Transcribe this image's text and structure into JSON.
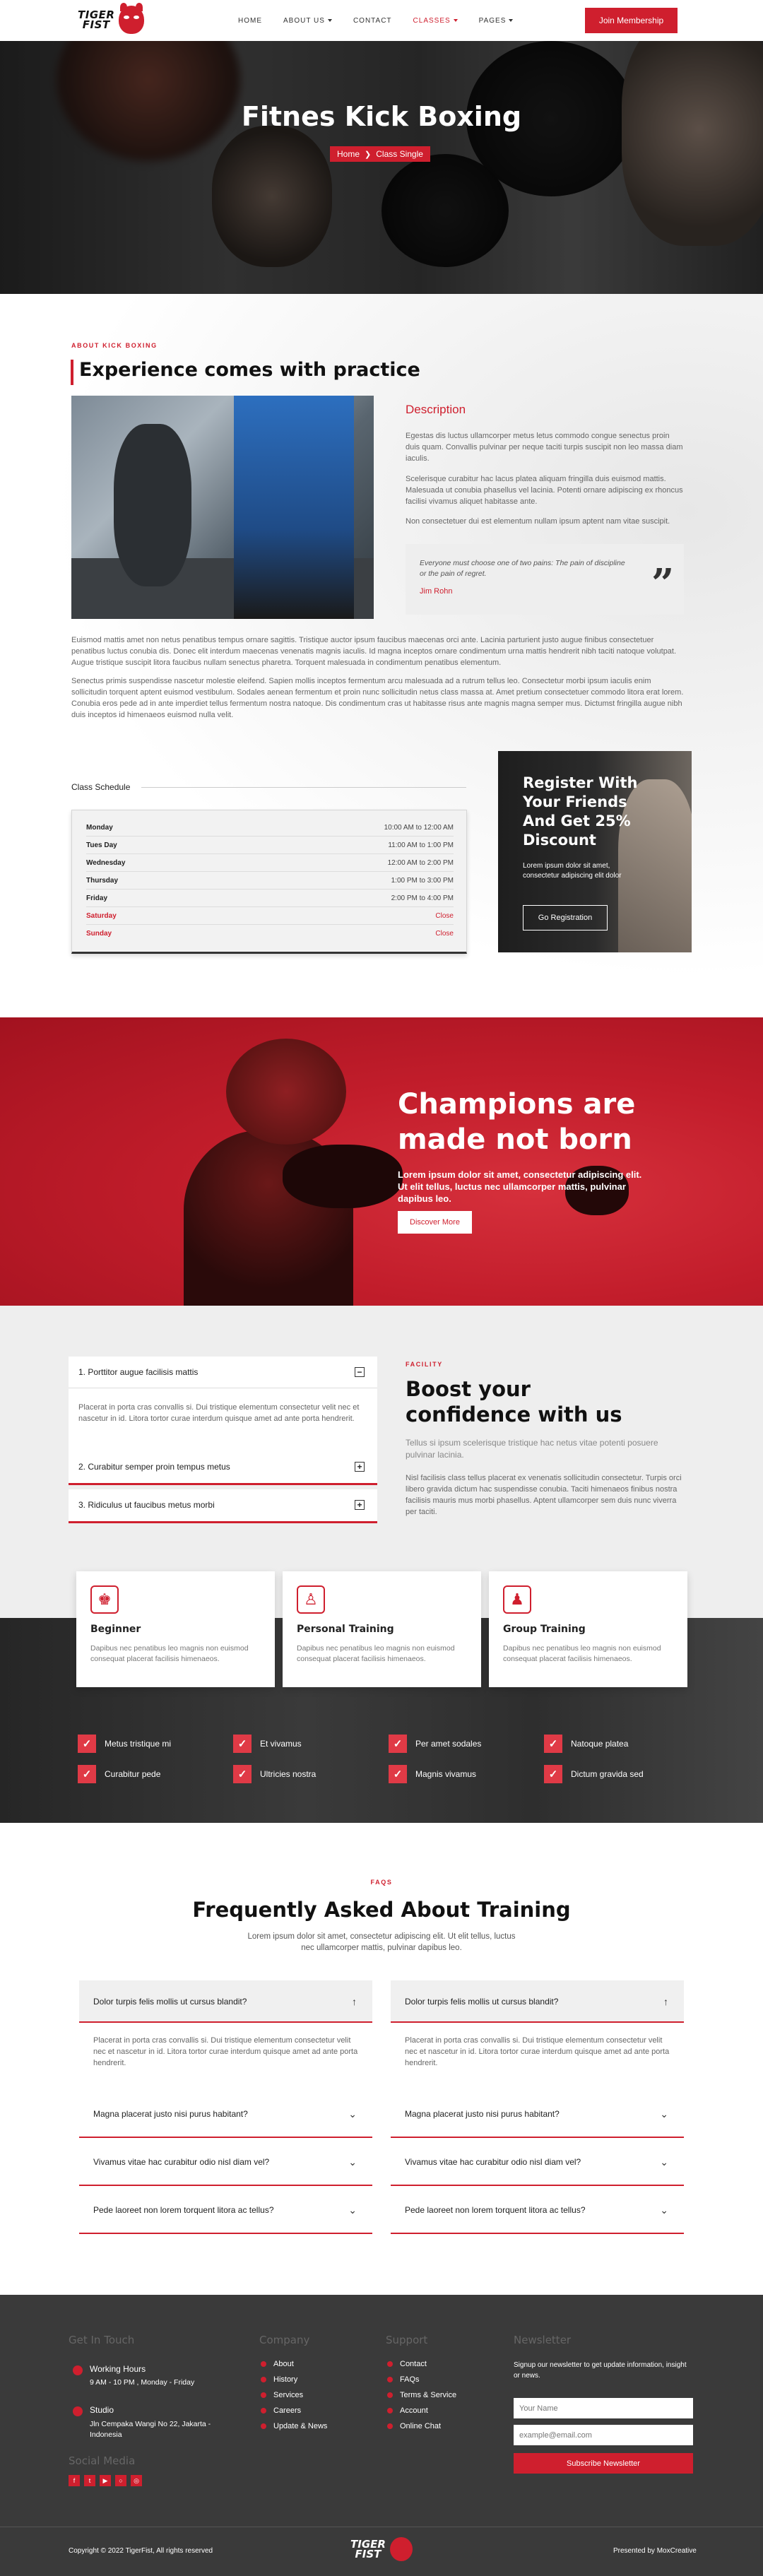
{
  "brand": {
    "line1": "TIGER",
    "line2": "FIST"
  },
  "nav": {
    "items": [
      {
        "label": "HOME",
        "caret": false,
        "active": false
      },
      {
        "label": "ABOUT US",
        "caret": true,
        "active": false
      },
      {
        "label": "CONTACT",
        "caret": false,
        "active": false
      },
      {
        "label": "CLASSES",
        "caret": true,
        "active": true
      },
      {
        "label": "PAGES",
        "caret": true,
        "active": false
      }
    ],
    "cta": "Join Membership"
  },
  "hero": {
    "title": "Fitnes Kick Boxing",
    "crumb_home": "Home",
    "crumb_current": "Class Single"
  },
  "about": {
    "eyebrow": "ABOUT KICK BOXING",
    "title": "Experience comes with practice",
    "description_heading": "Description",
    "desc_p1": "Egestas dis luctus ullamcorper metus letus commodo congue senectus proin duis quam. Convallis pulvinar per neque taciti turpis suscipit non leo massa diam iaculis.",
    "desc_p2": "Scelerisque curabitur hac lacus platea aliquam fringilla duis euismod mattis. Malesuada ut conubia phasellus vel lacinia. Potenti ornare adipiscing ex rhoncus facilisi vivamus aliquet habitasse ante.",
    "desc_p3": "Non consectetuer dui est elementum nullam ipsum aptent nam vitae suscipit.",
    "quote_text": "Everyone must choose one of two pains: The pain of discipline or the pain of regret.",
    "quote_author": "Jim Rohn",
    "body_p1": "Euismod mattis amet non netus penatibus tempus ornare sagittis. Tristique auctor ipsum faucibus maecenas orci ante. Lacinia parturient justo augue finibus consectetuer penatibus luctus conubia dis. Donec elit interdum maecenas venenatis magnis iaculis. Id magna inceptos ornare condimentum urna mattis hendrerit nibh taciti natoque volutpat. Augue tristique suscipit litora faucibus nullam senectus pharetra. Torquent malesuada in condimentum penatibus elementum.",
    "body_p2": "Senectus primis suspendisse nascetur molestie eleifend. Sapien mollis inceptos fermentum arcu malesuada ad a rutrum tellus leo. Consectetur morbi ipsum iaculis enim sollicitudin torquent aptent euismod vestibulum. Sodales aenean fermentum et proin nunc sollicitudin netus class massa at. Amet pretium consectetuer commodo litora erat lorem. Conubia eros pede ad in ante imperdiet tellus fermentum nostra natoque. Dis condimentum cras ut habitasse risus ante magnis magna semper mus. Dictumst fringilla augue nibh duis inceptos id himenaeos euismod nulla velit."
  },
  "schedule": {
    "label": "Class Schedule",
    "rows": [
      {
        "day": "Monday",
        "hours": "10:00 AM to 12:00 AM",
        "closed": false
      },
      {
        "day": "Tues Day",
        "hours": "11:00 AM to 1:00 PM",
        "closed": false
      },
      {
        "day": "Wednesday",
        "hours": "12:00 AM to 2:00 PM",
        "closed": false
      },
      {
        "day": "Thursday",
        "hours": "1:00 PM to 3:00 PM",
        "closed": false
      },
      {
        "day": "Friday",
        "hours": "2:00 PM to 4:00 PM",
        "closed": false
      },
      {
        "day": "Saturday",
        "hours": "Close",
        "closed": true
      },
      {
        "day": "Sunday",
        "hours": "Close",
        "closed": true
      }
    ]
  },
  "promo": {
    "title": "Register With Your Friends And Get 25% Discount",
    "text": "Lorem ipsum dolor sit amet, consectetur adipiscing elit dolor",
    "button": "Go Registration"
  },
  "banner": {
    "title": "Champions are made not born",
    "text": "Lorem ipsum dolor sit amet, consectetur adipiscing elit. Ut elit tellus, luctus nec ullamcorper mattis, pulvinar dapibus leo.",
    "button": "Discover More"
  },
  "facility": {
    "eyebrow": "FACILITY",
    "title": "Boost your confidence with us",
    "lead": "Tellus si ipsum scelerisque tristique hac netus vitae potenti posuere pulvinar lacinia.",
    "body": "Nisl facilisis class tellus placerat ex venenatis sollicitudin consectetur. Turpis orci libero gravida dictum hac suspendisse conubia. Taciti himenaeos finibus nostra facilisis mauris mus morbi phasellus. Aptent ullamcorper sem duis nunc viverra per taciti.",
    "accordion": [
      {
        "label": "1. Porttitor augue facilisis mattis",
        "icon": "minus",
        "body": "Placerat in porta cras convallis si. Dui tristique elementum consectetur velit nec et nascetur in id. Litora tortor curae interdum quisque amet ad ante porta hendrerit."
      },
      {
        "label": "2. Curabitur semper proin tempus metus",
        "icon": "plus"
      },
      {
        "label": "3. Ridiculus ut faucibus metus morbi",
        "icon": "plus"
      }
    ]
  },
  "cards": [
    {
      "title": "Beginner",
      "text": "Dapibus nec penatibus leo magnis non euismod consequat placerat facilisis himenaeos.",
      "icon": "boxer-icon"
    },
    {
      "title": "Personal Training",
      "text": "Dapibus nec penatibus leo magnis non euismod consequat placerat facilisis himenaeos.",
      "icon": "kick-icon"
    },
    {
      "title": "Group Training",
      "text": "Dapibus nec penatibus leo magnis non euismod consequat placerat facilisis himenaeos.",
      "icon": "group-icon"
    }
  ],
  "checks": [
    "Metus tristique mi",
    "Et vivamus",
    "Per amet sodales",
    "Natoque platea",
    "Curabitur pede",
    "Ultricies nostra",
    "Magnis vivamus",
    "Dictum gravida sed"
  ],
  "faq": {
    "eyebrow": "FAQS",
    "title": "Frequently Asked About Training",
    "subtitle": "Lorem ipsum dolor sit amet, consectetur adipiscing elit. Ut elit tellus, luctus nec ullamcorper mattis, pulvinar dapibus leo.",
    "open_body": "Placerat in porta cras convallis si. Dui tristique elementum consectetur velit nec et nascetur in id. Litora tortor curae interdum quisque amet ad ante porta hendrerit.",
    "left": [
      "Dolor turpis felis mollis ut cursus blandit?",
      "Magna placerat justo nisi purus habitant?",
      "Vivamus vitae hac curabitur odio nisl diam vel?",
      "Pede laoreet non lorem torquent litora ac tellus?"
    ],
    "right": [
      "Dolor turpis felis mollis ut cursus blandit?",
      "Magna placerat justo nisi purus habitant?",
      "Vivamus vitae hac curabitur odio nisl diam vel?",
      "Pede laoreet non lorem torquent litora ac tellus?"
    ]
  },
  "footer": {
    "get_in_touch": "Get In Touch",
    "hours_label": "Working Hours",
    "hours_value": "9 AM - 10 PM , Monday - Friday",
    "studio_label": "Studio",
    "studio_value": "Jln Cempaka Wangi No 22, Jakarta - Indonesia",
    "social_label": "Social Media",
    "company": "Company",
    "company_links": [
      "About",
      "History",
      "Services",
      "Careers",
      "Update & News"
    ],
    "support": "Support",
    "support_links": [
      "Contact",
      "FAQs",
      "Terms & Service",
      "Account",
      "Online Chat"
    ],
    "newsletter": "Newsletter",
    "newsletter_text": "Signup our newsletter to get update information, insight or news.",
    "name_placeholder": "Your Name",
    "email_placeholder": "example@email.com",
    "subscribe": "Subscribe Newsletter",
    "copyright": "Copyright © 2022 TigerFist, All rights reserved",
    "presented": "Presented by MoxCreative"
  }
}
